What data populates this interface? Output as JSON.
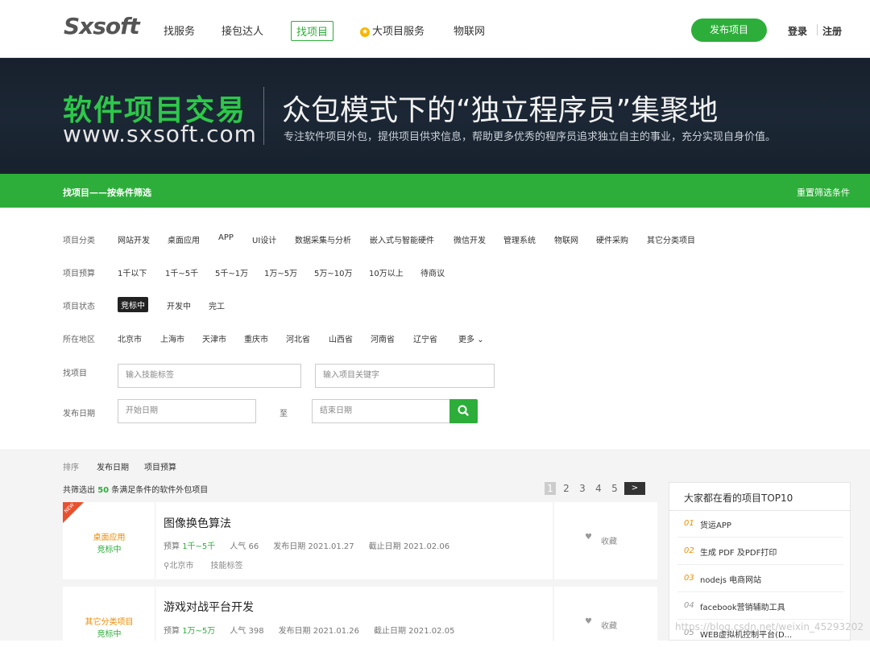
{
  "header": {
    "logo_text": "Sxsoft",
    "nav": [
      "找服务",
      "接包达人",
      "找项目",
      "大项目服务",
      "物联网"
    ],
    "publish_label": "发布项目",
    "login_label": "登录",
    "register_label": "注册"
  },
  "banner": {
    "title": "软件项目交易",
    "url": "www.sxsoft.com",
    "headline": "众包模式下的“独立程序员”集聚地",
    "subtitle": "专注软件项目外包，提供项目供求信息，帮助更多优秀的程序员追求独立自主的事业，充分实现自身价值。"
  },
  "filterbar": {
    "title": "找项目——按条件筛选",
    "reset_label": "重置筛选条件"
  },
  "filters": {
    "category_label": "项目分类",
    "categories": [
      "网站开发",
      "桌面应用",
      "APP",
      "UI设计",
      "数据采集与分析",
      "嵌入式与智能硬件",
      "微信开发",
      "管理系统",
      "物联网",
      "硬件采购",
      "其它分类项目"
    ],
    "budget_label": "项目预算",
    "budgets": [
      "1千以下",
      "1千~5千",
      "5千~1万",
      "1万~5万",
      "5万~10万",
      "10万以上",
      "待商议"
    ],
    "status_label": "项目状态",
    "statuses": [
      "竞标中",
      "开发中",
      "完工"
    ],
    "region_label": "所在地区",
    "regions": [
      "北京市",
      "上海市",
      "天津市",
      "重庆市",
      "河北省",
      "山西省",
      "河南省",
      "辽宁省"
    ],
    "more_label": "更多",
    "search_label": "找项目",
    "skill_placeholder": "输入技能标签",
    "keyword_placeholder": "输入项目关键字",
    "date_label": "发布日期",
    "start_placeholder": "开始日期",
    "to_label": "至",
    "end_placeholder": "结束日期"
  },
  "sort": {
    "label": "排序",
    "options": [
      "发布日期",
      "项目预算"
    ]
  },
  "results": {
    "prefix": "共筛选出",
    "count": "50",
    "suffix": "条满足条件的软件外包项目",
    "pages": [
      "1",
      "2",
      "3",
      "4",
      "5"
    ],
    "next": ">"
  },
  "projects": [
    {
      "category": "桌面应用",
      "status": "竞标中",
      "title": "图像换色算法",
      "budget_label": "预算",
      "budget": "1千~5千",
      "popularity": "人气 66",
      "published": "发布日期 2021.01.27",
      "deadline": "截止日期 2021.02.06",
      "location": "北京市",
      "skills": "技能标签",
      "fav": "收藏",
      "new_tag": "NEW"
    },
    {
      "category": "其它分类项目",
      "status": "竞标中",
      "title": "游戏对战平台开发",
      "budget_label": "预算",
      "budget": "1万~5万",
      "popularity": "人气 398",
      "published": "发布日期 2021.01.26",
      "deadline": "截止日期 2021.02.05",
      "fav": "收藏"
    }
  ],
  "top10": {
    "title": "大家都在看的项目TOP10",
    "items": [
      {
        "n": "01",
        "t": "货运APP"
      },
      {
        "n": "02",
        "t": "生成 PDF 及PDF打印"
      },
      {
        "n": "03",
        "t": "nodejs 电商网站"
      },
      {
        "n": "04",
        "t": "facebook营销辅助工具"
      },
      {
        "n": "05",
        "t": "WEB虚拟机控制平台(D..."
      }
    ]
  },
  "watermark": "https://blog.csdn.net/weixin_45293202",
  "colors": {
    "brand_green": "#2dae3a",
    "orange": "#f08c00",
    "banner_bg": "#1a2431"
  }
}
